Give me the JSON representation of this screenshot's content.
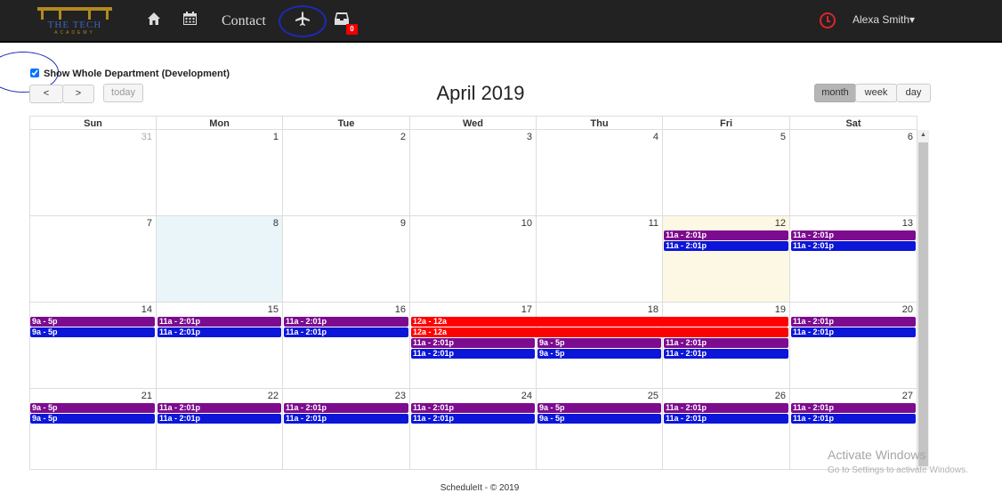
{
  "nav": {
    "logo_text": "THE TECH",
    "logo_subtitle": "ACADEMY",
    "home_icon": "home-icon",
    "calendar_icon": "calendar-icon",
    "contact_label": "Contact",
    "flight_icon": "airplane-icon",
    "inbox_icon": "inbox-icon",
    "inbox_count": "0",
    "clock_icon": "clock-icon",
    "user_name": "Alexa Smith",
    "user_caret": "▾"
  },
  "filter": {
    "label": "Show Whole Department (Development)",
    "checked": true
  },
  "toolbar": {
    "prev": "<",
    "next": ">",
    "today": "today",
    "title": "April 2019",
    "views": [
      "month",
      "week",
      "day"
    ],
    "active_view": "month"
  },
  "days": [
    "Sun",
    "Mon",
    "Tue",
    "Wed",
    "Thu",
    "Fri",
    "Sat"
  ],
  "weeks": [
    [
      "31",
      "1",
      "2",
      "3",
      "4",
      "5",
      "6"
    ],
    [
      "7",
      "8",
      "9",
      "10",
      "11",
      "12",
      "13"
    ],
    [
      "14",
      "15",
      "16",
      "17",
      "18",
      "19",
      "20"
    ],
    [
      "21",
      "22",
      "23",
      "24",
      "25",
      "26",
      "27"
    ]
  ],
  "today_date": "12",
  "selected_date": "8",
  "colors": {
    "purple": "#7d0b8f",
    "blue": "#0c16d9",
    "red": "#ff0000",
    "today_bg": "#fcf8e3",
    "selected_bg": "#eaf5fa"
  },
  "events": [
    {
      "week": 1,
      "day": 5,
      "row": 0,
      "span": 1,
      "color": "purple",
      "label": "11a - 2:01p"
    },
    {
      "week": 1,
      "day": 5,
      "row": 1,
      "span": 1,
      "color": "blue",
      "label": "11a - 2:01p"
    },
    {
      "week": 1,
      "day": 6,
      "row": 0,
      "span": 1,
      "color": "purple",
      "label": "11a - 2:01p"
    },
    {
      "week": 1,
      "day": 6,
      "row": 1,
      "span": 1,
      "color": "blue",
      "label": "11a - 2:01p"
    },
    {
      "week": 2,
      "day": 0,
      "row": 0,
      "span": 1,
      "color": "purple",
      "label": "9a - 5p"
    },
    {
      "week": 2,
      "day": 0,
      "row": 1,
      "span": 1,
      "color": "blue",
      "label": "9a - 5p"
    },
    {
      "week": 2,
      "day": 1,
      "row": 0,
      "span": 1,
      "color": "purple",
      "label": "11a - 2:01p"
    },
    {
      "week": 2,
      "day": 1,
      "row": 1,
      "span": 1,
      "color": "blue",
      "label": "11a - 2:01p"
    },
    {
      "week": 2,
      "day": 2,
      "row": 0,
      "span": 1,
      "color": "purple",
      "label": "11a - 2:01p"
    },
    {
      "week": 2,
      "day": 2,
      "row": 1,
      "span": 1,
      "color": "blue",
      "label": "11a - 2:01p"
    },
    {
      "week": 2,
      "day": 3,
      "row": 0,
      "span": 3,
      "color": "red",
      "label": "12a - 12a"
    },
    {
      "week": 2,
      "day": 3,
      "row": 1,
      "span": 3,
      "color": "red",
      "label": "12a - 12a"
    },
    {
      "week": 2,
      "day": 3,
      "row": 2,
      "span": 1,
      "color": "purple",
      "label": "11a - 2:01p"
    },
    {
      "week": 2,
      "day": 3,
      "row": 3,
      "span": 1,
      "color": "blue",
      "label": "11a - 2:01p"
    },
    {
      "week": 2,
      "day": 4,
      "row": 2,
      "span": 1,
      "color": "purple",
      "label": "9a - 5p"
    },
    {
      "week": 2,
      "day": 4,
      "row": 3,
      "span": 1,
      "color": "blue",
      "label": "9a - 5p"
    },
    {
      "week": 2,
      "day": 5,
      "row": 2,
      "span": 1,
      "color": "purple",
      "label": "11a - 2:01p"
    },
    {
      "week": 2,
      "day": 5,
      "row": 3,
      "span": 1,
      "color": "blue",
      "label": "11a - 2:01p"
    },
    {
      "week": 2,
      "day": 6,
      "row": 0,
      "span": 1,
      "color": "purple",
      "label": "11a - 2:01p"
    },
    {
      "week": 2,
      "day": 6,
      "row": 1,
      "span": 1,
      "color": "blue",
      "label": "11a - 2:01p"
    },
    {
      "week": 3,
      "day": 0,
      "row": 0,
      "span": 1,
      "color": "purple",
      "label": "9a - 5p"
    },
    {
      "week": 3,
      "day": 0,
      "row": 1,
      "span": 1,
      "color": "blue",
      "label": "9a - 5p"
    },
    {
      "week": 3,
      "day": 1,
      "row": 0,
      "span": 1,
      "color": "purple",
      "label": "11a - 2:01p"
    },
    {
      "week": 3,
      "day": 1,
      "row": 1,
      "span": 1,
      "color": "blue",
      "label": "11a - 2:01p"
    },
    {
      "week": 3,
      "day": 2,
      "row": 0,
      "span": 1,
      "color": "purple",
      "label": "11a - 2:01p"
    },
    {
      "week": 3,
      "day": 2,
      "row": 1,
      "span": 1,
      "color": "blue",
      "label": "11a - 2:01p"
    },
    {
      "week": 3,
      "day": 3,
      "row": 0,
      "span": 1,
      "color": "purple",
      "label": "11a - 2:01p"
    },
    {
      "week": 3,
      "day": 3,
      "row": 1,
      "span": 1,
      "color": "blue",
      "label": "11a - 2:01p"
    },
    {
      "week": 3,
      "day": 4,
      "row": 0,
      "span": 1,
      "color": "purple",
      "label": "9a - 5p"
    },
    {
      "week": 3,
      "day": 4,
      "row": 1,
      "span": 1,
      "color": "blue",
      "label": "9a - 5p"
    },
    {
      "week": 3,
      "day": 5,
      "row": 0,
      "span": 1,
      "color": "purple",
      "label": "11a - 2:01p"
    },
    {
      "week": 3,
      "day": 5,
      "row": 1,
      "span": 1,
      "color": "blue",
      "label": "11a - 2:01p"
    },
    {
      "week": 3,
      "day": 6,
      "row": 0,
      "span": 1,
      "color": "purple",
      "label": "11a - 2:01p"
    },
    {
      "week": 3,
      "day": 6,
      "row": 1,
      "span": 1,
      "color": "blue",
      "label": "11a - 2:01p"
    }
  ],
  "watermark": {
    "title": "Activate Windows",
    "subtitle": "Go to Settings to activate Windows."
  },
  "footer": "ScheduleIt - © 2019"
}
